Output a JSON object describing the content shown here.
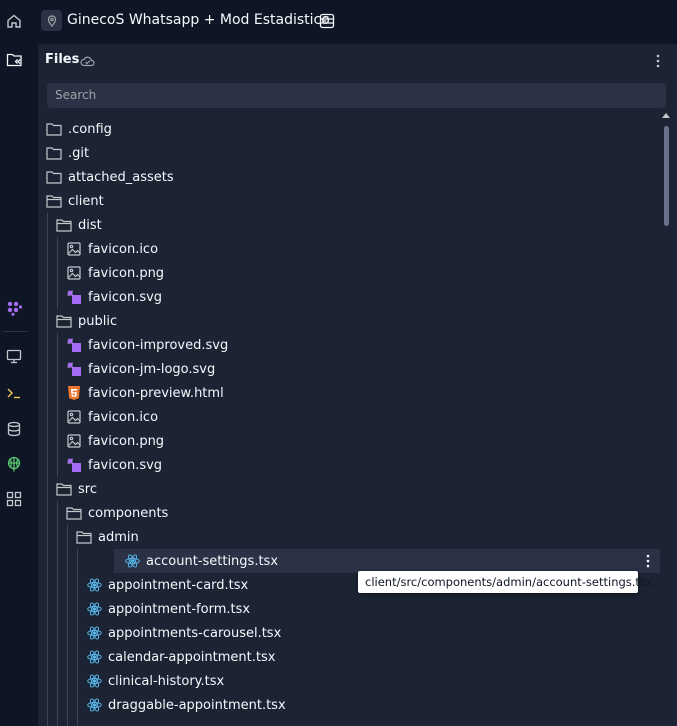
{
  "app": {
    "title": "GinecoS Whatsapp + Mod Estadistico"
  },
  "files_pane": {
    "title": "Files",
    "search_placeholder": "Search"
  },
  "tooltip": "client/src/components/admin/account-settings.tsx",
  "tree": [
    {
      "label": ".config",
      "type": "folder",
      "depth": 0
    },
    {
      "label": ".git",
      "type": "folder",
      "depth": 0
    },
    {
      "label": "attached_assets",
      "type": "folder",
      "depth": 0
    },
    {
      "label": "client",
      "type": "folder-open",
      "depth": 0
    },
    {
      "label": "dist",
      "type": "folder-open",
      "depth": 1
    },
    {
      "label": "favicon.ico",
      "type": "image",
      "depth": 2
    },
    {
      "label": "favicon.png",
      "type": "image",
      "depth": 2
    },
    {
      "label": "favicon.svg",
      "type": "svg",
      "depth": 2
    },
    {
      "label": "public",
      "type": "folder-open",
      "depth": 1
    },
    {
      "label": "favicon-improved.svg",
      "type": "svg",
      "depth": 2
    },
    {
      "label": "favicon-jm-logo.svg",
      "type": "svg",
      "depth": 2
    },
    {
      "label": "favicon-preview.html",
      "type": "html",
      "depth": 2
    },
    {
      "label": "favicon.ico",
      "type": "image",
      "depth": 2
    },
    {
      "label": "favicon.png",
      "type": "image",
      "depth": 2
    },
    {
      "label": "favicon.svg",
      "type": "svg",
      "depth": 2
    },
    {
      "label": "src",
      "type": "folder-open",
      "depth": 1
    },
    {
      "label": "components",
      "type": "folder-open",
      "depth": 2
    },
    {
      "label": "admin",
      "type": "folder-open",
      "depth": 3
    },
    {
      "label": "account-settings.tsx",
      "type": "react",
      "depth": 4,
      "selected": true
    },
    {
      "label": "appointment-card.tsx",
      "type": "react",
      "depth": 4
    },
    {
      "label": "appointment-form.tsx",
      "type": "react",
      "depth": 4
    },
    {
      "label": "appointments-carousel.tsx",
      "type": "react",
      "depth": 4
    },
    {
      "label": "calendar-appointment.tsx",
      "type": "react",
      "depth": 4
    },
    {
      "label": "clinical-history.tsx",
      "type": "react",
      "depth": 4
    },
    {
      "label": "draggable-appointment.tsx",
      "type": "react",
      "depth": 4
    }
  ],
  "icons": {
    "rail": [
      "home-icon",
      "files-icon",
      "extensions-icon",
      "preview-icon",
      "shell-icon",
      "database-icon",
      "deploy-icon",
      "apps-icon"
    ]
  },
  "colors": {
    "accent_svg": "#a46cf5",
    "react": "#56b3e6",
    "html": "#e8762d"
  }
}
